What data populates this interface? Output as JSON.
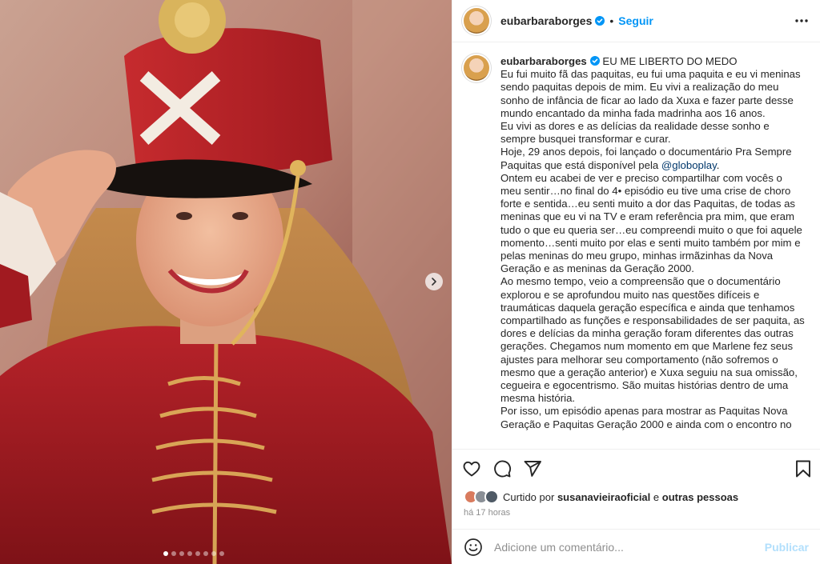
{
  "colors": {
    "accent": "#0095f6",
    "text": "#262626",
    "muted": "#8e8e8e",
    "mention": "#00376b",
    "publish_disabled": "#b2dffc"
  },
  "post": {
    "username": "eubarbaraborges",
    "follow_label": "Seguir",
    "separator": "•",
    "media": {
      "slide_count": 8,
      "active_slide": 1
    }
  },
  "caption": {
    "username": "eubarbaraborges",
    "title": "EU ME LIBERTO DO MEDO",
    "p1": "Eu fui muito fã das paquitas, eu fui uma paquita e eu vi meninas sendo paquitas depois de mim. Eu vivi a realização do meu sonho de infância de ficar ao lado da Xuxa e fazer parte desse mundo encantado da minha fada madrinha aos 16 anos.",
    "p2": "Eu vivi as dores e as delícias da realidade desse sonho e sempre busquei transformar e curar.",
    "p3_before": "Hoje, 29 anos depois, foi lançado o documentário Pra Sempre Paquitas que está disponível pela ",
    "p3_mention": "@globoplay",
    "p3_after": ".",
    "p4": "Ontem eu acabei de ver e preciso compartilhar com vocês o meu sentir…no final do 4• episódio eu tive uma crise de choro forte e sentida…eu senti muito a dor das Paquitas, de todas as meninas que eu vi na TV e eram referência pra mim, que eram tudo o que eu queria ser…eu compreendi muito o que foi aquele momento…senti muito por elas e senti muito também por mim e pelas meninas do meu grupo, minhas irmãzinhas da Nova Geração e as meninas da Geração 2000.",
    "p5": "Ao mesmo tempo, veio a compreensão que o documentário explorou e se aprofundou muito nas questões difíceis e traumáticas daquela geração específica e ainda que tenhamos compartilhado as funções e responsabilidades de ser paquita, as dores e delícias da minha geração foram diferentes das outras gerações. Chegamos num momento em que Marlene fez seus ajustes para melhorar seu comportamento (não sofremos o mesmo que a geração anterior) e Xuxa seguiu na sua omissão, cegueira e egocentrismo. São muitas histórias dentro de uma mesma história.",
    "p6": "Por isso, um episódio apenas para mostrar as Paquitas Nova Geração e Paquitas Geração 2000 e ainda com o encontro no"
  },
  "likes": {
    "prefix": "Curtido por",
    "user": "susanavieiraoficial",
    "connector": "e",
    "others": "outras pessoas"
  },
  "timestamp": "há 17 horas",
  "comment": {
    "placeholder": "Adicione um comentário...",
    "publish_label": "Publicar"
  },
  "icons": {
    "verified": "verified-badge-icon",
    "more": "more-options-icon",
    "like": "heart-icon",
    "comment": "comment-icon",
    "share": "share-icon",
    "save": "bookmark-icon",
    "emoji": "emoji-icon",
    "next": "chevron-right-icon"
  }
}
